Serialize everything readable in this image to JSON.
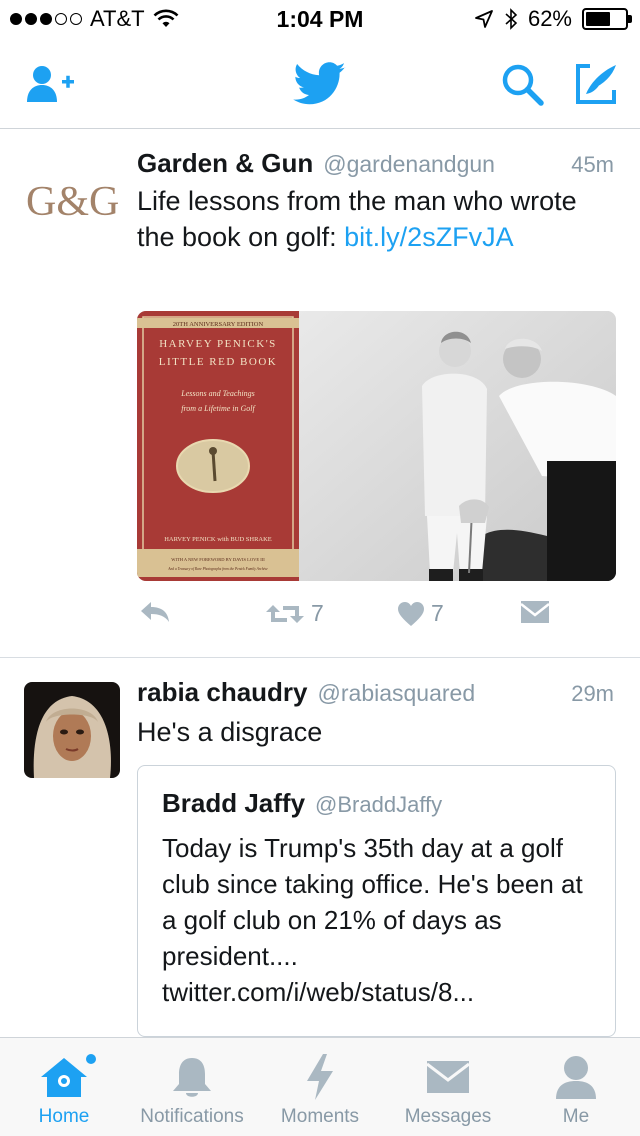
{
  "status_bar": {
    "carrier": "AT&T",
    "time": "1:04 PM",
    "battery": "62%",
    "battery_level": 0.62
  },
  "nav": {
    "icons": [
      "add-user-icon",
      "twitter-bird-icon",
      "search-icon",
      "compose-icon"
    ]
  },
  "tweets": [
    {
      "name": "Garden & Gun",
      "handle": "@gardenandgun",
      "time": "45m",
      "avatar_text": "G&G",
      "text_prefix": "Life lessons from the man who wrote the book on golf: ",
      "link": "bit.ly/2sZFvJA",
      "media": {
        "book_edition": "20TH ANNIVERSARY EDITION",
        "book_title_1": "HARVEY PENICK'S",
        "book_title_2": "LITTLE RED BOOK",
        "book_subtitle_1": "Lessons and Teachings",
        "book_subtitle_2": "from a Lifetime in Golf",
        "book_authors": "HARVEY PENICK with BUD SHRAKE",
        "book_foreword_1": "WITH A NEW FOREWORD BY DAVIS LOVE III",
        "book_foreword_2": "And a Treasury of Rare Photographs from the Penick Family Archive"
      },
      "retweets": "7",
      "likes": "7"
    },
    {
      "name": "rabia chaudry",
      "handle": "@rabiasquared",
      "time": "29m",
      "text": "He's a disgrace",
      "quote": {
        "name": "Bradd Jaffy",
        "handle": "@BraddJaffy",
        "text": "Today is Trump's 35th day at a golf club since taking office. He's been at a golf club on 21% of days as president.... twitter.com/i/web/status/8..."
      }
    }
  ],
  "tabs": [
    {
      "label": "Home",
      "icon": "home-icon",
      "active": true
    },
    {
      "label": "Notifications",
      "icon": "bell-icon",
      "active": false
    },
    {
      "label": "Moments",
      "icon": "lightning-icon",
      "active": false
    },
    {
      "label": "Messages",
      "icon": "envelope-icon",
      "active": false
    },
    {
      "label": "Me",
      "icon": "person-icon",
      "active": false
    }
  ],
  "colors": {
    "accent": "#1da1f2",
    "muted": "#8899a6",
    "text": "#14171a"
  }
}
